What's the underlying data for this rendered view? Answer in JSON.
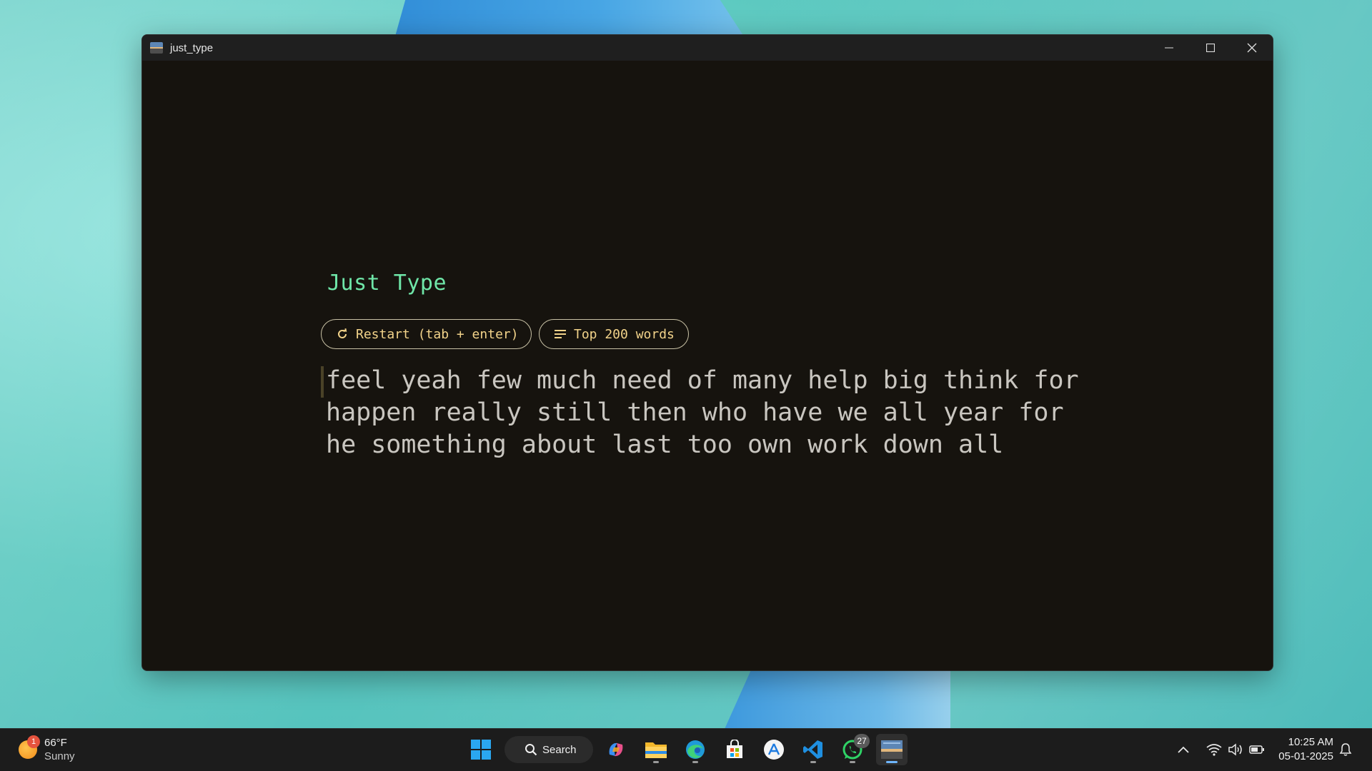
{
  "window": {
    "title": "just_type",
    "controls": [
      "minimize-icon",
      "maximize-icon",
      "close-icon"
    ]
  },
  "app": {
    "title": "Just Type",
    "restart_label": "Restart (tab + enter)",
    "mode_label": "Top 200 words",
    "word_lines": [
      "feel yeah few much need of many help big think for",
      "happen really still then who have we all year for",
      "he something about last too own work down all"
    ]
  },
  "colors": {
    "app_background": "#16130e",
    "title_green": "#6fe6a8",
    "pill_text": "#f2d38a",
    "words_text": "#c9c6c0"
  },
  "taskbar": {
    "weather": {
      "temp": "66°F",
      "condition": "Sunny",
      "badge": "1"
    },
    "search_label": "Search",
    "apps": [
      "start-icon",
      "search",
      "copilot-icon",
      "file-explorer-icon",
      "edge-icon",
      "store-icon",
      "app-store-icon",
      "vscode-icon",
      "whatsapp-icon",
      "just-type-icon"
    ],
    "whatsapp_badge": "27",
    "clock": {
      "time": "10:25 AM",
      "date": "05-01-2025"
    }
  }
}
